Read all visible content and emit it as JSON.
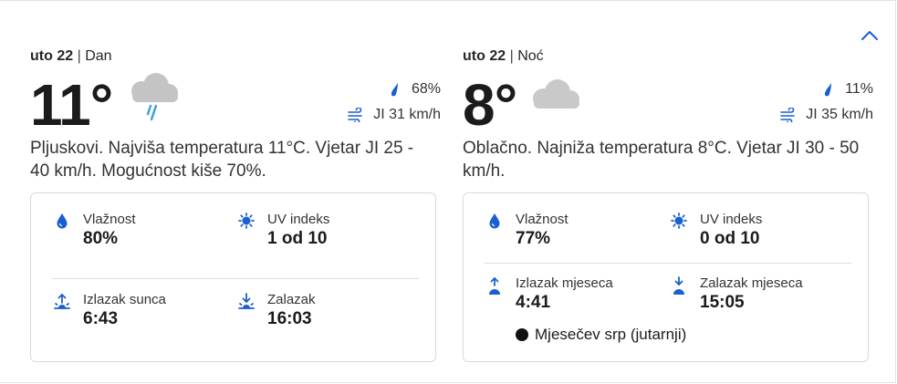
{
  "day": {
    "date_bold": "uto 22",
    "separator": "|",
    "part": "Dan",
    "temperature": "11°",
    "weather_icon": "cloud-rain-icon",
    "precip": "68%",
    "wind": "JI 31 km/h",
    "description": "Pljuskovi. Najviša temperatura 11°C. Vjetar JI 25 - 40 km/h. Mogućnost kiše 70%.",
    "humidity_label": "Vlažnost",
    "humidity_value": "80%",
    "uv_label": "UV indeks",
    "uv_value": "1 od 10",
    "sunrise_label": "Izlazak sunca",
    "sunrise_value": "6:43",
    "sunset_label": "Zalazak",
    "sunset_value": "16:03"
  },
  "night": {
    "date_bold": "uto 22",
    "separator": "|",
    "part": "Noć",
    "temperature": "8°",
    "weather_icon": "cloud-icon",
    "precip": "11%",
    "wind": "JI 35 km/h",
    "description": "Oblačno. Najniža temperatura 8°C. Vjetar JI 30 - 50 km/h.",
    "humidity_label": "Vlažnost",
    "humidity_value": "77%",
    "uv_label": "UV indeks",
    "uv_value": "0 od 10",
    "moonrise_label": "Izlazak mjeseca",
    "moonrise_value": "4:41",
    "moonset_label": "Zalazak mjeseca",
    "moonset_value": "15:05",
    "moon_phase": "Mjesečev srp (jutarnji)"
  },
  "colors": {
    "accent_blue": "#1a5fd1",
    "cloud_gray": "#c9c9c9",
    "text": "#1f1f1f"
  }
}
